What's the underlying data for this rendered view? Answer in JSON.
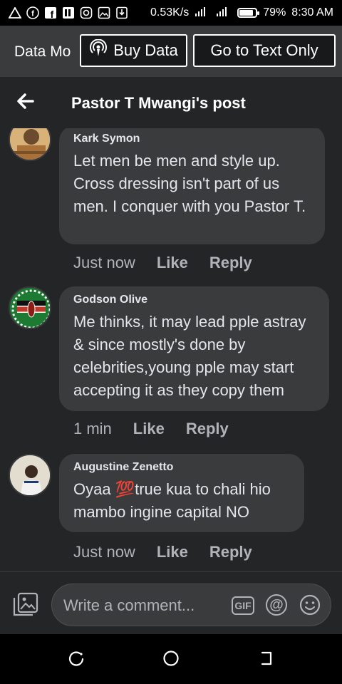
{
  "status_bar": {
    "speed": "0.53K/s",
    "battery": "79%",
    "time": "8:30 AM",
    "battery_level": 0.79,
    "left_icons": [
      "alert-triangle-icon",
      "facebook-icon",
      "facebook-icon",
      "facebook-lite-icon",
      "instagram-icon",
      "gallery-icon",
      "download-icon"
    ]
  },
  "data_bar": {
    "mode_label": "Data Mo",
    "buy_label": "Buy Data",
    "text_only_label": "Go to Text Only"
  },
  "header": {
    "title": "Pastor T Mwangi's post"
  },
  "comments": [
    {
      "author": "Kark Symon",
      "text": "Let men be men and style up. Cross dressing isn't part of us men. I conquer with you Pastor T.",
      "time": "Just now",
      "like": "Like",
      "reply": "Reply"
    },
    {
      "author": "Godson Olive",
      "text": "Me thinks, it may lead pple astray & since mostly's done by celebrities,young pple may start accepting it as they copy them",
      "time": "1 min",
      "like": "Like",
      "reply": "Reply"
    },
    {
      "author": "Augustine Zenetto",
      "text": "Oyaa 💯true kua to chali hio mambo ingine capital NO",
      "time": "Just now",
      "like": "Like",
      "reply": "Reply"
    }
  ],
  "composer": {
    "placeholder": "Write a comment...",
    "gif_label": "GIF",
    "at_label": "@"
  },
  "colors": {
    "background": "#18191a",
    "surface": "#242526",
    "bubble": "#3a3b3c",
    "text": "#e4e6eb",
    "muted": "#b0b3b8"
  }
}
